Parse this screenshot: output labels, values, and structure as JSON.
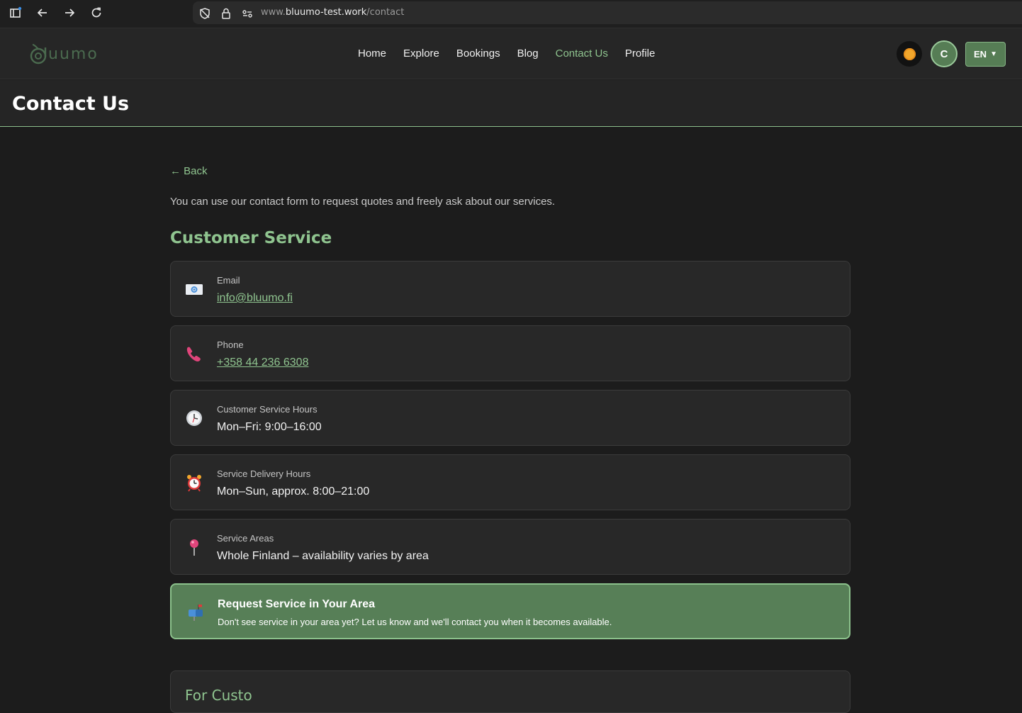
{
  "browser": {
    "url_prefix": "www.",
    "url_domain": "bluumo-test.work",
    "url_path": "/contact"
  },
  "header": {
    "logo_text": "uumo",
    "nav": [
      "Home",
      "Explore",
      "Bookings",
      "Blog",
      "Contact Us",
      "Profile"
    ],
    "active_nav": "Contact Us",
    "avatar_initial": "C",
    "language": "EN",
    "language_caret": "▼"
  },
  "page": {
    "title": "Contact Us",
    "back_label": "← Back",
    "intro": "You can use our contact form to request quotes and freely ask about our services.",
    "section_title": "Customer Service"
  },
  "cards": [
    {
      "label": "Email",
      "value": "info@bluumo.fi",
      "icon": "envelope-icon"
    },
    {
      "label": "Phone",
      "value": "+358 44 236 6308",
      "icon": "phone-icon"
    },
    {
      "label": "Customer Service Hours",
      "value": "Mon–Fri: 9:00–16:00",
      "icon": "clock-icon"
    },
    {
      "label": "Service Delivery Hours",
      "value": "Mon–Sun, approx. 8:00–21:00",
      "icon": "alarm-clock-icon"
    },
    {
      "label": "Service Areas",
      "value": "Whole Finland – availability varies by area",
      "icon": "pin-icon"
    }
  ],
  "cta": {
    "title": "Request Service in Your Area",
    "description": "Don't see service in your area yet? Let us know and we'll contact you when it becomes available.",
    "icon": "mailbox-icon"
  },
  "partial_section": {
    "title": "For Custo"
  },
  "colors": {
    "accent": "#8fc48f",
    "button_green": "#567d55",
    "background": "#1c1c1c"
  }
}
